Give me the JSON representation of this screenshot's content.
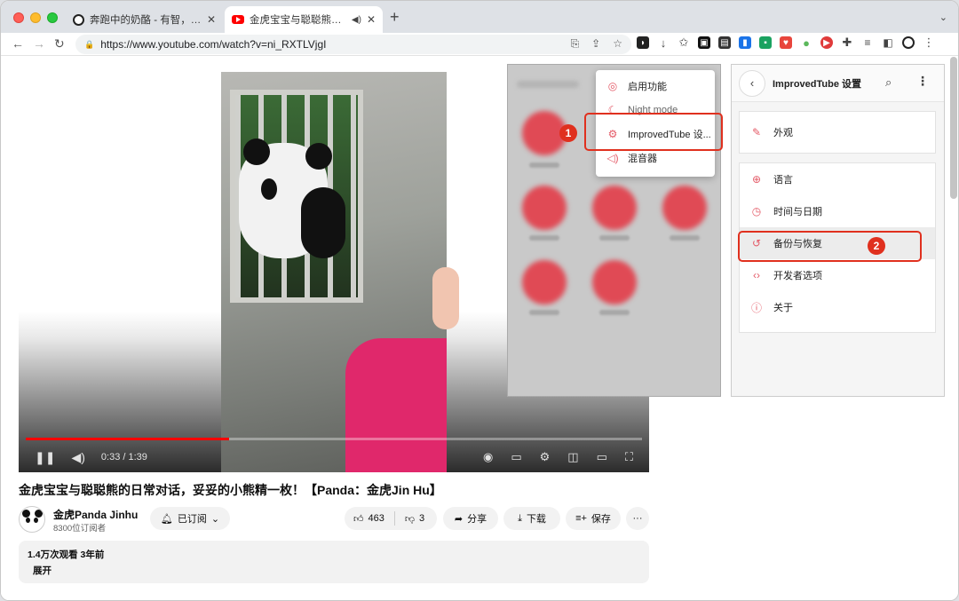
{
  "browser": {
    "tabs": [
      {
        "title": "奔跑中的奶酪 - 有智，有趣，有..."
      },
      {
        "title": "金虎宝宝与聪聪熊的日常对话..."
      }
    ],
    "url": "https://www.youtube.com/watch?v=ni_RXTLVjgI",
    "new_tab_glyph": "+",
    "tab_menu_glyph": "⌄"
  },
  "video": {
    "time_text": "0:33 / 1:39",
    "progress": 0.33,
    "title": "金虎宝宝与聪聪熊的日常对话，妥妥的小熊精一枚！【Panda：金虎Jin Hu】",
    "channel_name": "金虎Panda Jinhu",
    "subscribers": "8300位订阅者",
    "subscribe_label": "已订阅",
    "like_count": "463",
    "dislike_count": "3",
    "share_label": "分享",
    "download_label": "下载",
    "save_label": "保存",
    "more_label": "···",
    "views_meta": "1.4万次观看  3年前",
    "expand_label": "展开"
  },
  "popup_menu": {
    "items": [
      {
        "label": "启用功能",
        "icon": "check-circle-icon"
      },
      {
        "label": "Night mode",
        "icon": "moon-icon"
      },
      {
        "label": "ImprovedTube 设...",
        "icon": "gear-icon"
      },
      {
        "label": "混音器",
        "icon": "speaker-icon"
      }
    ]
  },
  "settings": {
    "title": "ImprovedTube 设置",
    "appearance": "外观",
    "items": [
      {
        "label": "语言",
        "icon": "globe-icon"
      },
      {
        "label": "时间与日期",
        "icon": "clock-icon"
      },
      {
        "label": "备份与恢复",
        "icon": "history-icon"
      },
      {
        "label": "开发者选项",
        "icon": "code-icon"
      },
      {
        "label": "关于",
        "icon": "info-icon"
      }
    ]
  },
  "annotations": {
    "badge1": "1",
    "badge2": "2",
    "color": "#e0301e"
  },
  "colors": {
    "accent": "#e45a67",
    "youtube_red": "#ff0000"
  }
}
